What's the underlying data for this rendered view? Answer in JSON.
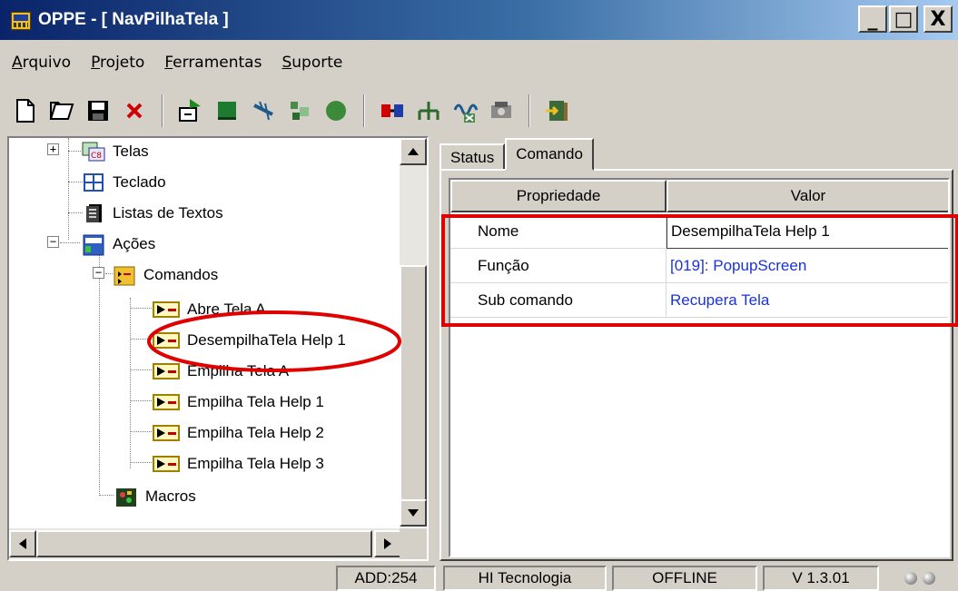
{
  "window": {
    "title": "OPPE - [ NavPilhaTela ]",
    "buttons": {
      "minimize": "_",
      "maximize": "□",
      "close": "X"
    }
  },
  "menu": [
    {
      "prefix": "",
      "accel": "A",
      "rest": "rquivo"
    },
    {
      "prefix": "",
      "accel": "P",
      "rest": "rojeto"
    },
    {
      "prefix": "",
      "accel": "F",
      "rest": "erramentas"
    },
    {
      "prefix": "",
      "accel": "S",
      "rest": "uporte"
    }
  ],
  "toolbar": {
    "icons": [
      "new-file-icon",
      "open-folder-icon",
      "save-icon",
      "delete-icon",
      "add-screen-icon",
      "block-icon",
      "wand-icon",
      "component-icon",
      "circle-icon",
      "connect-icon",
      "network-icon",
      "signal-icon",
      "device-icon",
      "exit-icon"
    ]
  },
  "tree": {
    "nodes": [
      {
        "label": "Telas",
        "icon": "screens-icon"
      },
      {
        "label": "Teclado",
        "icon": "keyboard-icon"
      },
      {
        "label": "Listas de Textos",
        "icon": "text-list-icon"
      },
      {
        "label": "Ações",
        "icon": "actions-icon"
      },
      {
        "label": "Comandos",
        "icon": "commands-folder-icon"
      },
      {
        "label": "Abre Tela A",
        "icon": "command-icon"
      },
      {
        "label": "DesempilhaTela Help 1",
        "icon": "command-icon"
      },
      {
        "label": "Empilha Tela A",
        "icon": "command-icon"
      },
      {
        "label": "Empilha Tela Help 1",
        "icon": "command-icon"
      },
      {
        "label": "Empilha Tela Help 2",
        "icon": "command-icon"
      },
      {
        "label": "Empilha Tela Help 3",
        "icon": "command-icon"
      },
      {
        "label": "Macros",
        "icon": "macros-icon"
      }
    ],
    "expanders": {
      "expanded": "−",
      "collapsed": "+"
    }
  },
  "tabs": [
    "Status",
    "Comando"
  ],
  "grid": {
    "headers": [
      "Propriedade",
      "Valor"
    ],
    "rows": [
      {
        "prop": "Nome",
        "value": "DesempilhaTela Help 1"
      },
      {
        "prop": "Função",
        "value": "[019]: PopupScreen"
      },
      {
        "prop": "Sub comando",
        "value": "Recupera Tela"
      }
    ]
  },
  "statusbar": {
    "address": "ADD:254",
    "company": "HI Tecnologia",
    "connection": "OFFLINE",
    "version": "V 1.3.01"
  },
  "colors": {
    "title_start": "#0a246a",
    "title_end": "#a6caf0",
    "link": "#1a32d8",
    "annotation": "#e00000",
    "face": "#d4d0c8"
  }
}
